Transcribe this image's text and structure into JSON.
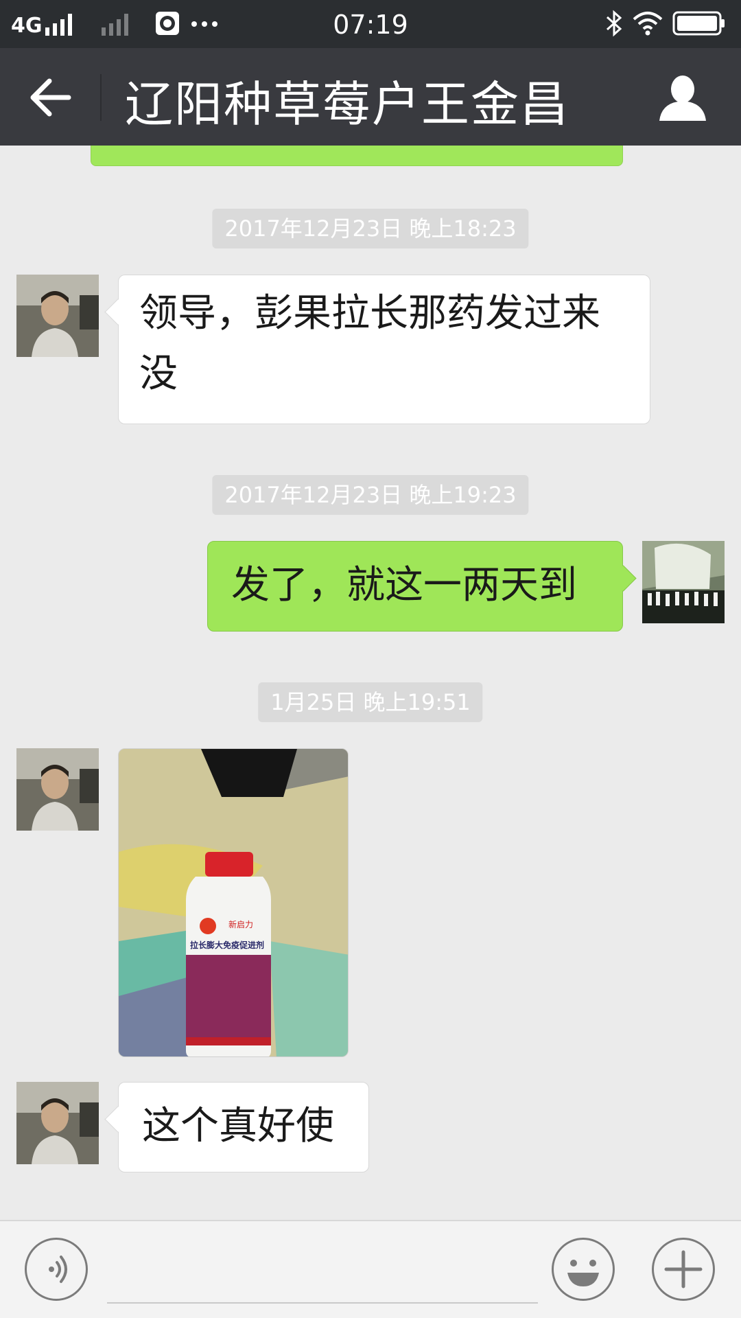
{
  "status_bar": {
    "network": "4G",
    "time": "07:19",
    "icons": [
      "signal-icon",
      "signal-dim-icon",
      "app-notification-icon",
      "more-dots-icon",
      "bluetooth-icon",
      "wifi-icon",
      "battery-icon"
    ]
  },
  "header": {
    "title": "辽阳种草莓户王金昌",
    "icons": [
      "back-arrow-icon",
      "profile-icon"
    ]
  },
  "messages": [
    {
      "type": "timestamp",
      "text": "2017年12月23日 晚上18:23"
    },
    {
      "type": "text",
      "side": "left",
      "text_line1": "领导，彭果拉长那药发过来",
      "text_line2": "没"
    },
    {
      "type": "timestamp",
      "text": "2017年12月23日 晚上19:23"
    },
    {
      "type": "text",
      "side": "right",
      "text": "发了，就这一两天到"
    },
    {
      "type": "timestamp",
      "text": "1月25日 晚上19:51"
    },
    {
      "type": "image",
      "side": "left"
    },
    {
      "type": "text",
      "side": "left",
      "text": "这个真好使"
    }
  ],
  "photo": {
    "brand": "新启力",
    "product": "拉长膨大免疫促进剂"
  },
  "input_bar": {
    "icons": [
      "voice-icon",
      "emoji-icon",
      "plus-icon"
    ],
    "input_value": ""
  },
  "colors": {
    "status_bar_bg": "#2b2e31",
    "header_bg": "#393a3f",
    "chat_bg": "#ebebeb",
    "sent_bubble": "#9fe658",
    "received_bubble": "#ffffff",
    "timestamp_bg": "#dadada"
  }
}
